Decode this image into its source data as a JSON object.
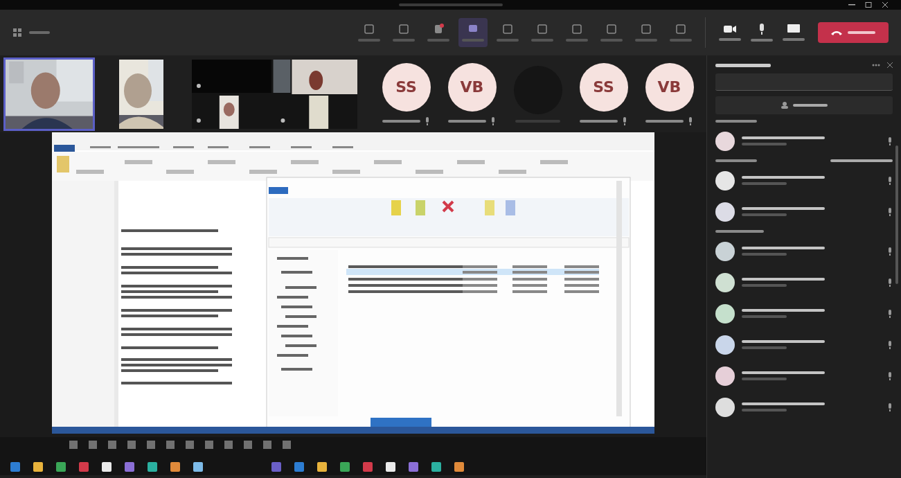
{
  "toolbar": {
    "center_items": [
      {
        "kind": "plain"
      },
      {
        "kind": "plain"
      },
      {
        "kind": "alert"
      },
      {
        "kind": "highlight"
      },
      {
        "kind": "plain"
      },
      {
        "kind": "plain"
      },
      {
        "kind": "plain"
      },
      {
        "kind": "plain"
      },
      {
        "kind": "plain"
      },
      {
        "kind": "plain"
      }
    ],
    "device_items": [
      {
        "kind": "camera"
      },
      {
        "kind": "mic"
      },
      {
        "kind": "share"
      }
    ]
  },
  "video_strip": [
    {
      "kind": "picture",
      "selected": true
    },
    {
      "kind": "picture",
      "selected": false
    },
    {
      "kind": "collage",
      "selected": false
    },
    {
      "kind": "avatar",
      "initials": "SS",
      "selected": false
    },
    {
      "kind": "avatar",
      "initials": "VB",
      "selected": false
    },
    {
      "kind": "dark",
      "selected": false
    },
    {
      "kind": "avatar",
      "initials": "SS",
      "selected": false
    },
    {
      "kind": "avatar",
      "initials": "VB",
      "selected": false
    }
  ],
  "shared_screen": {
    "kind": "document"
  },
  "participants": {
    "groups": [
      {
        "members": [
          {
            "color": "#e8d8dc"
          }
        ]
      },
      {
        "members": [
          {
            "color": "#e6e6e6"
          },
          {
            "color": "#dcdce6"
          }
        ]
      },
      {
        "members": [
          {
            "color": "#c9d2d6"
          },
          {
            "color": "#cfe0d2"
          },
          {
            "color": "#c5e0cc"
          },
          {
            "color": "#c9d6ea"
          },
          {
            "color": "#e6cfd8"
          },
          {
            "color": "#dedede"
          }
        ]
      }
    ]
  }
}
